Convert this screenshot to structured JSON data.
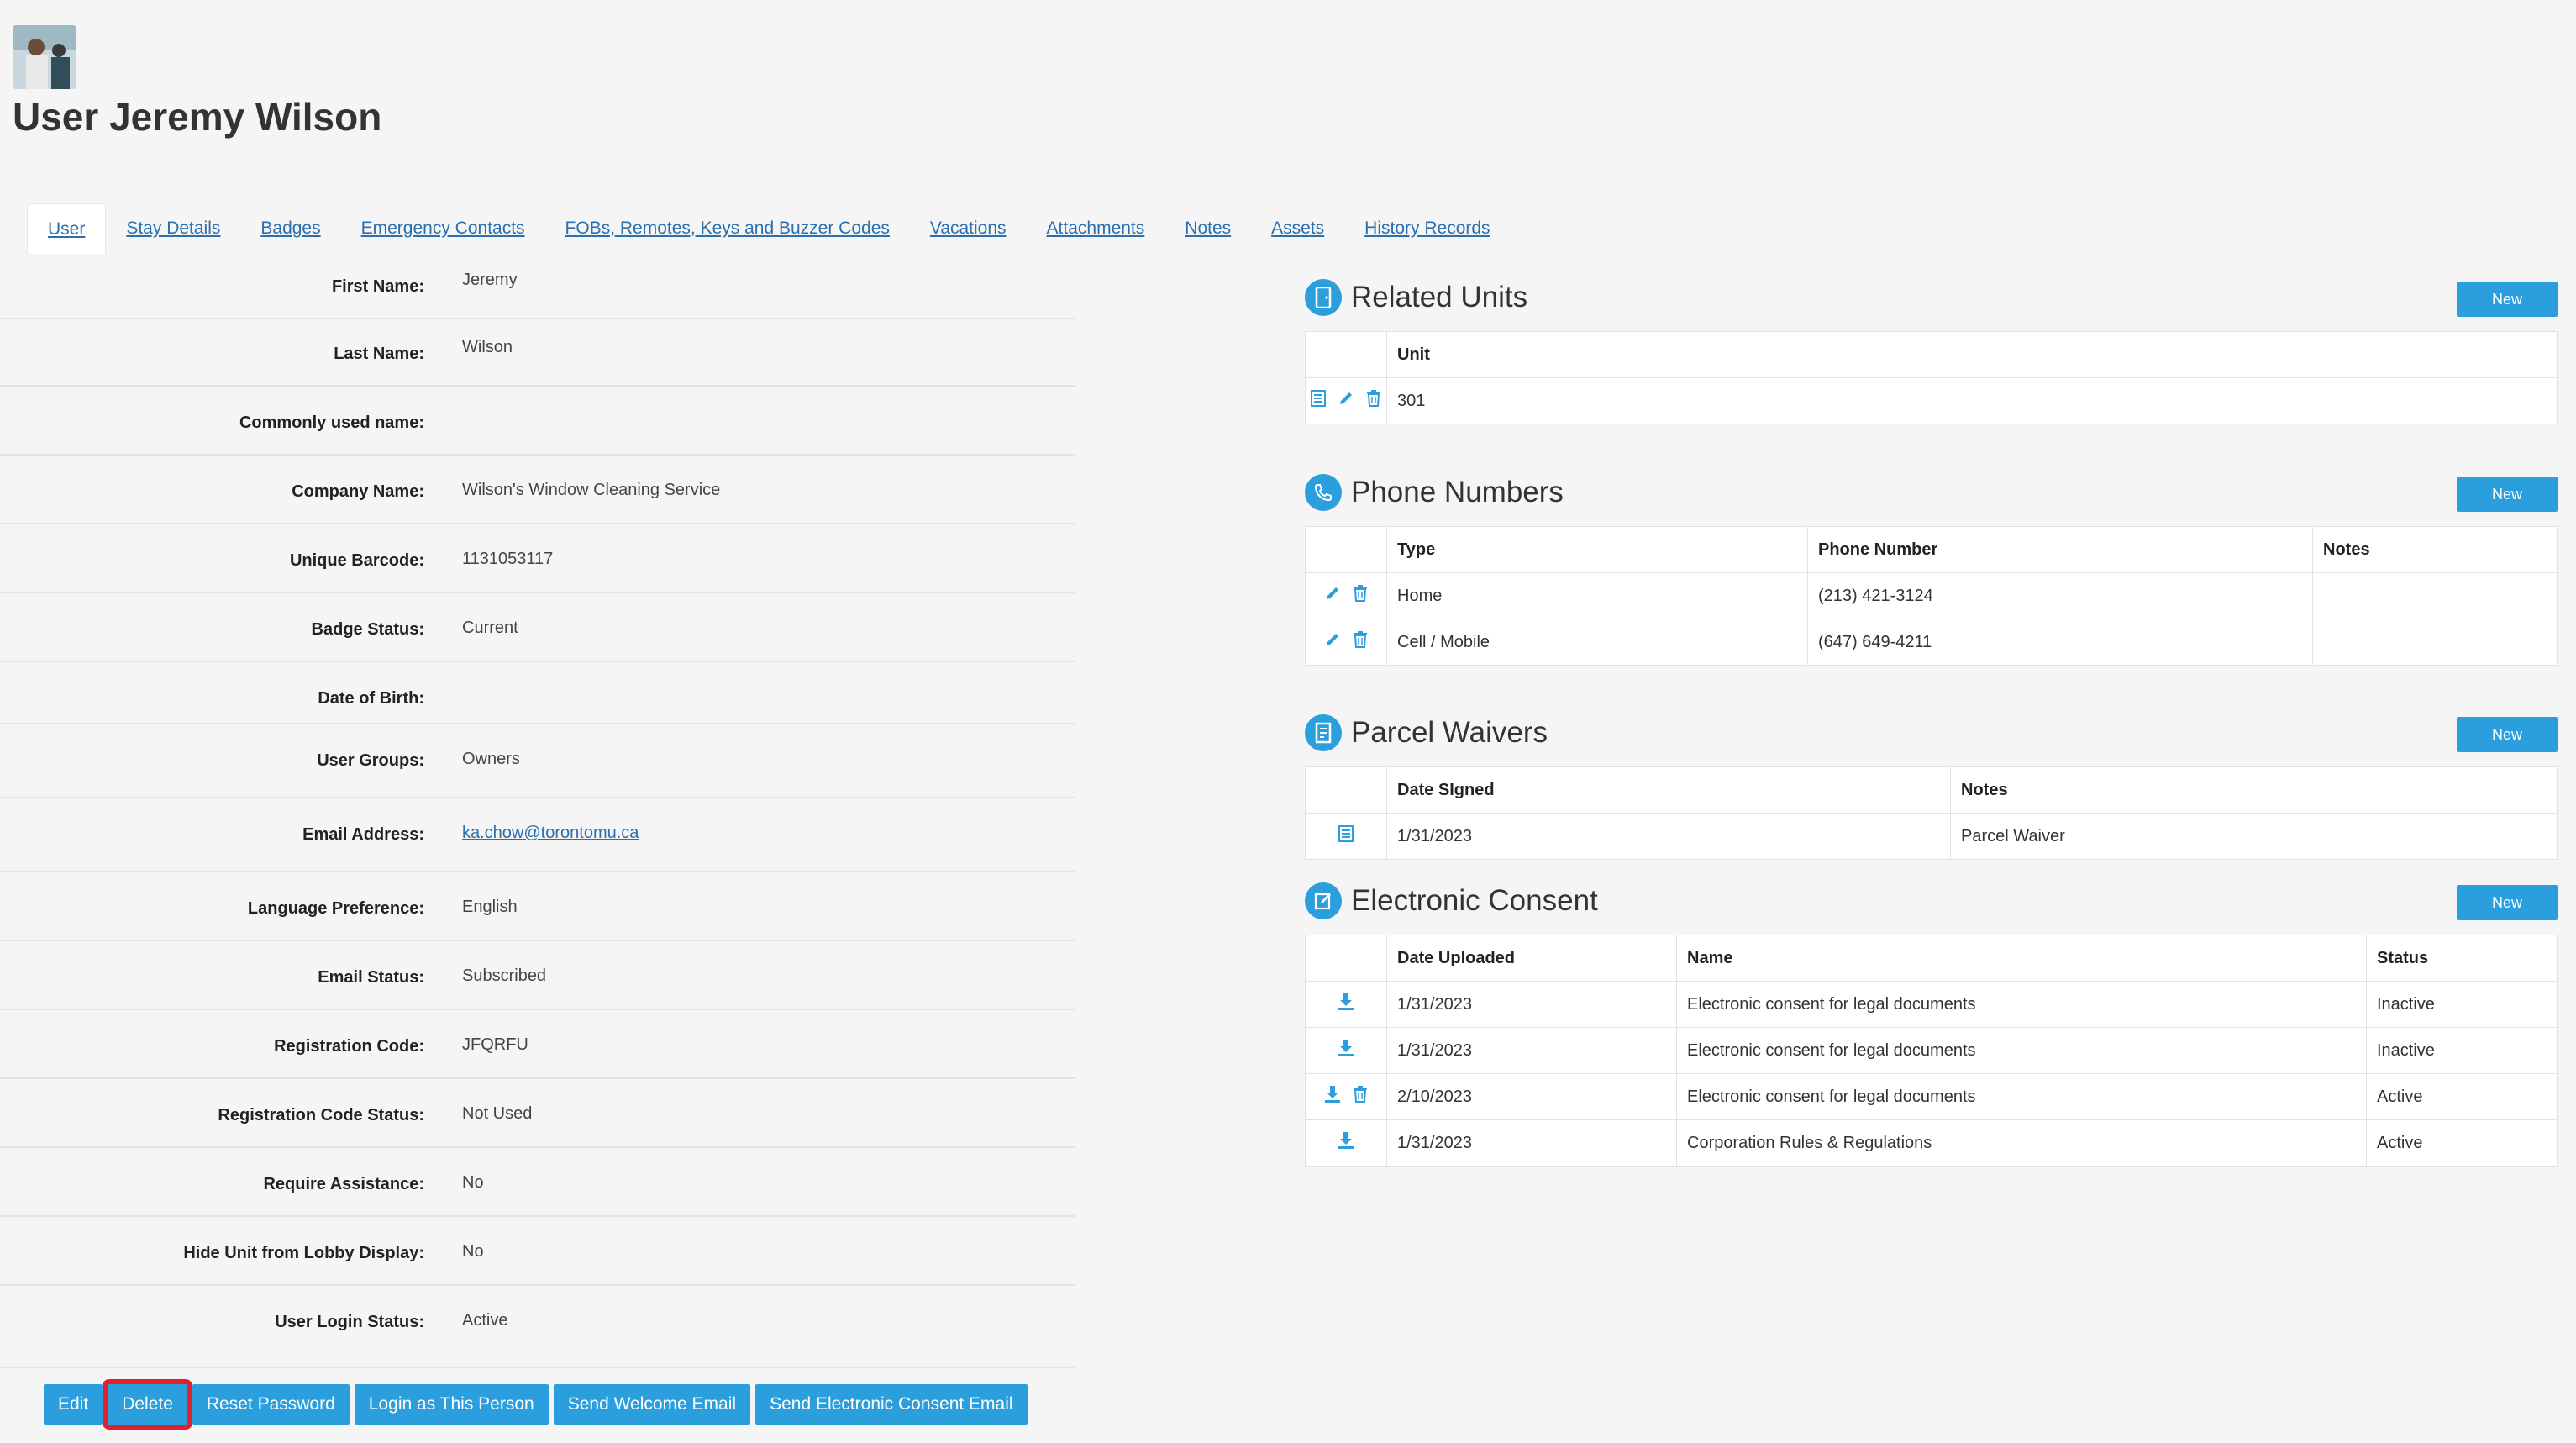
{
  "page": {
    "title": "User Jeremy Wilson"
  },
  "tabs": [
    {
      "label": "User"
    },
    {
      "label": "Stay Details"
    },
    {
      "label": "Badges"
    },
    {
      "label": "Emergency Contacts"
    },
    {
      "label": "FOBs, Remotes, Keys and Buzzer Codes"
    },
    {
      "label": "Vacations"
    },
    {
      "label": "Attachments"
    },
    {
      "label": "Notes"
    },
    {
      "label": "Assets"
    },
    {
      "label": "History Records"
    }
  ],
  "user": {
    "fields": [
      {
        "label": "First Name:",
        "value": "Jeremy"
      },
      {
        "label": "Last Name:",
        "value": "Wilson"
      },
      {
        "label": "Commonly used name:",
        "value": ""
      },
      {
        "label": "Company Name:",
        "value": "Wilson's Window Cleaning Service"
      },
      {
        "label": "Unique Barcode:",
        "value": "1131053117"
      },
      {
        "label": "Badge Status:",
        "value": "Current"
      },
      {
        "label": "Date of Birth:",
        "value": ""
      },
      {
        "label": "User Groups:",
        "value": "Owners"
      },
      {
        "label": "Email Address:",
        "value": "ka.chow@torontomu.ca"
      },
      {
        "label": "Language Preference:",
        "value": "English"
      },
      {
        "label": "Email Status:",
        "value": "Subscribed"
      },
      {
        "label": "Registration Code:",
        "value": "JFQRFU"
      },
      {
        "label": "Registration Code Status:",
        "value": "Not Used"
      },
      {
        "label": "Require Assistance:",
        "value": "No"
      },
      {
        "label": "Hide Unit from Lobby Display:",
        "value": "No"
      },
      {
        "label": "User Login Status:",
        "value": "Active"
      }
    ]
  },
  "actions": {
    "edit": "Edit",
    "delete": "Delete",
    "reset_password": "Reset Password",
    "login_as": "Login as This Person",
    "send_welcome": "Send Welcome Email",
    "send_consent": "Send Electronic Consent Email"
  },
  "related_units": {
    "title": "Related Units",
    "new_label": "New",
    "headers": {
      "unit": "Unit"
    },
    "rows": [
      {
        "unit": "301"
      }
    ]
  },
  "phone_numbers": {
    "title": "Phone Numbers",
    "new_label": "New",
    "headers": {
      "type": "Type",
      "number": "Phone Number",
      "notes": "Notes"
    },
    "rows": [
      {
        "type": "Home",
        "number": "(213) 421-3124",
        "notes": ""
      },
      {
        "type": "Cell / Mobile",
        "number": "(647) 649-4211",
        "notes": ""
      }
    ]
  },
  "parcel_waivers": {
    "title": "Parcel Waivers",
    "new_label": "New",
    "headers": {
      "date": "Date SIgned",
      "notes": "Notes"
    },
    "rows": [
      {
        "date": "1/31/2023",
        "notes": "Parcel Waiver"
      }
    ]
  },
  "electronic_consent": {
    "title": "Electronic Consent",
    "new_label": "New",
    "headers": {
      "date": "Date Uploaded",
      "name": "Name",
      "status": "Status"
    },
    "rows": [
      {
        "date": "1/31/2023",
        "name": "Electronic consent for legal documents",
        "status": "Inactive"
      },
      {
        "date": "1/31/2023",
        "name": "Electronic consent for legal documents",
        "status": "Inactive"
      },
      {
        "date": "2/10/2023",
        "name": "Electronic consent for legal documents",
        "status": "Active"
      },
      {
        "date": "1/31/2023",
        "name": "Corporation Rules & Regulations",
        "status": "Active"
      }
    ]
  },
  "colors": {
    "accent": "#2b9fde",
    "highlight": "#e0222e",
    "link": "#2a6fb0"
  },
  "icons": {
    "avatar": "user-photo",
    "related_units": "unit-icon",
    "phone_numbers": "phone-icon",
    "parcel_waivers": "waiver-icon",
    "electronic_consent": "consent-icon",
    "view": "view-icon",
    "edit": "pencil-icon",
    "delete": "trash-icon",
    "download": "download-icon"
  }
}
